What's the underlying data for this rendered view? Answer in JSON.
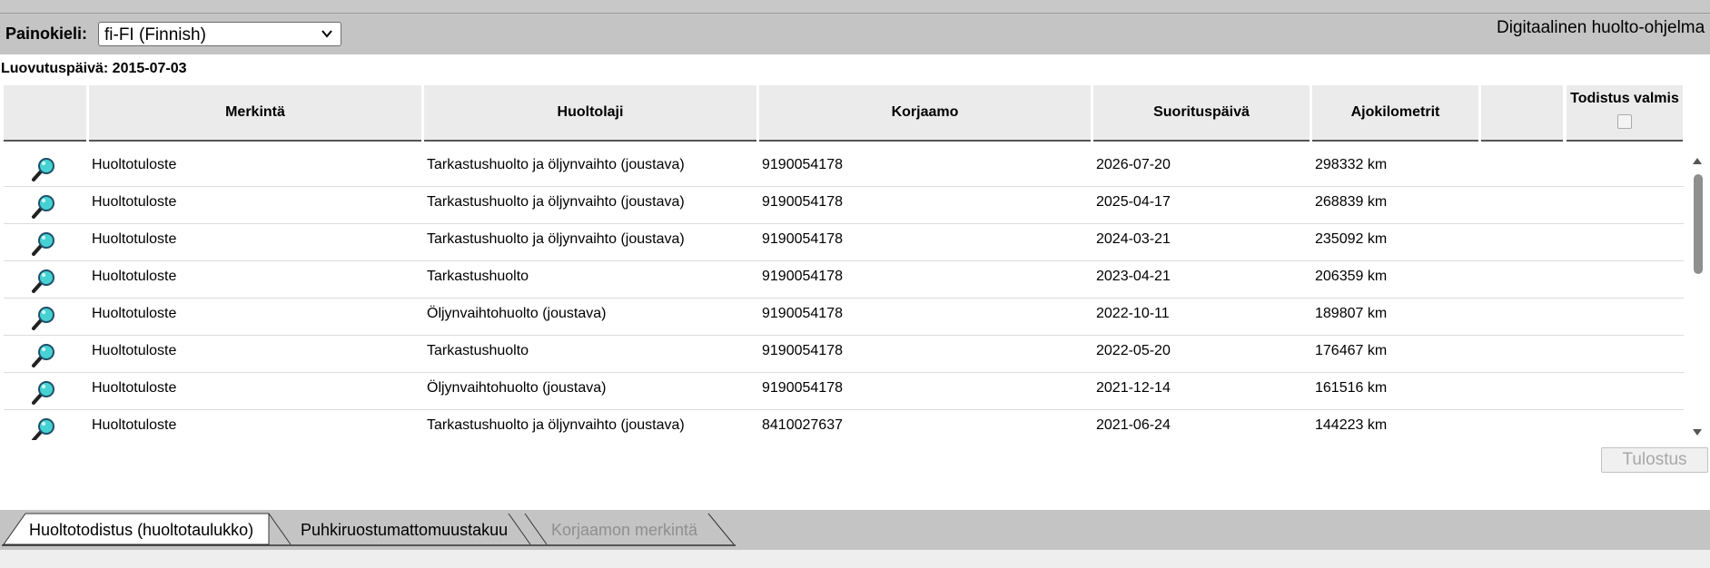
{
  "language": {
    "label": "Painokieli:",
    "selected": "fi-FI (Finnish)"
  },
  "app_title": "Digitaalinen huolto-ohjelma",
  "delivery_date": "Luovutuspäivä: 2015-07-03",
  "table": {
    "columns": {
      "icon": "",
      "entry": "Merkintä",
      "service_type": "Huoltolaji",
      "workshop": "Korjaamo",
      "date": "Suorituspäivä",
      "km": "Ajokilometrit",
      "extra": "",
      "certificate": "Todistus valmis"
    },
    "rows": [
      {
        "entry": "Huoltotuloste",
        "service_type": "Tarkastushuolto ja öljynvaihto (joustava)",
        "workshop": "9190054178",
        "date": "2026-07-20",
        "km": "298332 km"
      },
      {
        "entry": "Huoltotuloste",
        "service_type": "Tarkastushuolto ja öljynvaihto (joustava)",
        "workshop": "9190054178",
        "date": "2025-04-17",
        "km": "268839 km"
      },
      {
        "entry": "Huoltotuloste",
        "service_type": "Tarkastushuolto ja öljynvaihto (joustava)",
        "workshop": "9190054178",
        "date": "2024-03-21",
        "km": "235092 km"
      },
      {
        "entry": "Huoltotuloste",
        "service_type": "Tarkastushuolto",
        "workshop": "9190054178",
        "date": "2023-04-21",
        "km": "206359 km"
      },
      {
        "entry": "Huoltotuloste",
        "service_type": "Öljynvaihtohuolto (joustava)",
        "workshop": "9190054178",
        "date": "2022-10-11",
        "km": "189807 km"
      },
      {
        "entry": "Huoltotuloste",
        "service_type": "Tarkastushuolto",
        "workshop": "9190054178",
        "date": "2022-05-20",
        "km": "176467 km"
      },
      {
        "entry": "Huoltotuloste",
        "service_type": "Öljynvaihtohuolto (joustava)",
        "workshop": "9190054178",
        "date": "2021-12-14",
        "km": "161516 km"
      },
      {
        "entry": "Huoltotuloste",
        "service_type": "Tarkastushuolto ja öljynvaihto (joustava)",
        "workshop": "8410027637",
        "date": "2021-06-24",
        "km": "144223 km"
      }
    ],
    "row_icon": "magnifier-icon"
  },
  "print_button": "Tulostus",
  "tabs": [
    {
      "label": "Huoltotodistus (huoltotaulukko)",
      "state": "active"
    },
    {
      "label": "Puhkiruostumattomuustakuu",
      "state": "normal"
    },
    {
      "label": "Korjaamon merkintä",
      "state": "disabled"
    }
  ],
  "colors": {
    "bar_gray": "#c4c4c4",
    "header_gray": "#ebebeb",
    "magnifier_lens": "#46d2d2",
    "disabled_text": "#a7a7a7"
  }
}
